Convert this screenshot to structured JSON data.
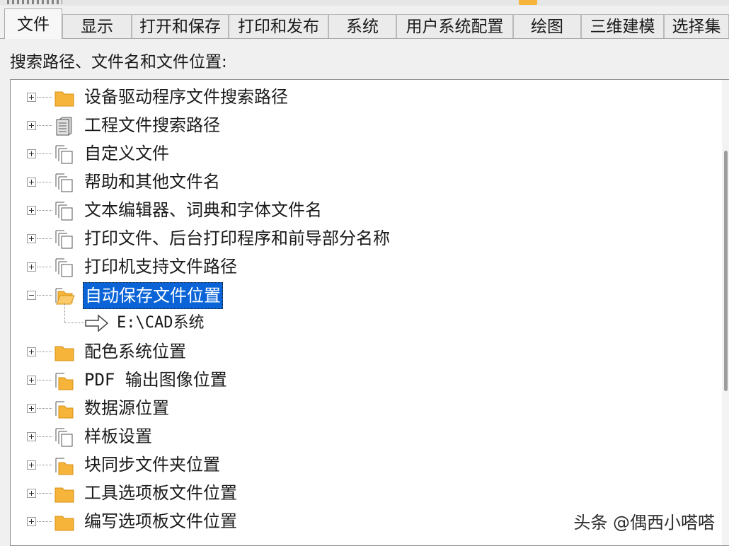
{
  "tabs": [
    "文件",
    "显示",
    "打开和保存",
    "打印和发布",
    "系统",
    "用户系统配置",
    "绘图",
    "三维建模",
    "选择集"
  ],
  "section_label": "搜索路径、文件名和文件位置:",
  "tree": {
    "items": [
      {
        "label": "设备驱动程序文件搜索路径",
        "icon": "folder-icon",
        "expanded": false
      },
      {
        "label": "工程文件搜索路径",
        "icon": "cabinet-icon",
        "expanded": false
      },
      {
        "label": "自定义文件",
        "icon": "multi-page-icon",
        "expanded": false
      },
      {
        "label": "帮助和其他文件名",
        "icon": "multi-page-icon",
        "expanded": false
      },
      {
        "label": "文本编辑器、词典和字体文件名",
        "icon": "multi-page-icon",
        "expanded": false
      },
      {
        "label": "打印文件、后台打印程序和前导部分名称",
        "icon": "multi-page-icon",
        "expanded": false
      },
      {
        "label": "打印机支持文件路径",
        "icon": "multi-page-icon",
        "expanded": false
      },
      {
        "label": "自动保存文件位置",
        "icon": "open-folder-icon",
        "expanded": true,
        "selected": true
      },
      {
        "label": "配色系统位置",
        "icon": "folder-icon",
        "expanded": false
      },
      {
        "label": "PDF 输出图像位置",
        "icon": "page-folder-icon",
        "expanded": false
      },
      {
        "label": "数据源位置",
        "icon": "page-folder-icon",
        "expanded": false
      },
      {
        "label": "样板设置",
        "icon": "multi-page-icon",
        "expanded": false
      },
      {
        "label": "块同步文件夹位置",
        "icon": "page-folder-icon",
        "expanded": false
      },
      {
        "label": "工具选项板文件位置",
        "icon": "folder-icon",
        "expanded": false
      },
      {
        "label": "编写选项板文件位置",
        "icon": "folder-icon",
        "expanded": false
      }
    ],
    "autosave_path": "E:\\CAD系统"
  },
  "watermark": "头条 @偶西小嗒嗒",
  "colors": {
    "selection": "#0a64d8",
    "folder": "#f6b43a",
    "background": "#f0f0f0"
  }
}
